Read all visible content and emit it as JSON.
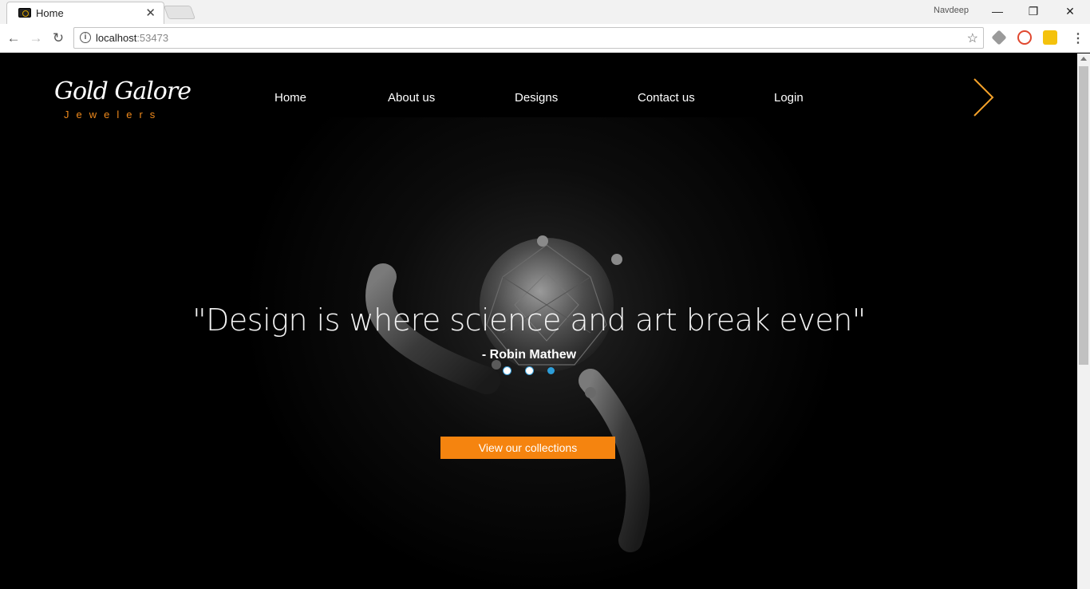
{
  "browser": {
    "tab_title": "Home",
    "tab_close": "✕",
    "profile_name": "Navdeep",
    "window_controls": {
      "minimize": "—",
      "restore": "❐",
      "close": "✕"
    },
    "nav": {
      "back": "←",
      "forward": "→",
      "reload": "↻"
    },
    "url_host": "localhost",
    "url_port": ":53473",
    "info_icon": "i",
    "bookmark_star": "☆",
    "menu": "⋮",
    "extensions": [
      "cube-extension-icon",
      "red-block-extension-icon",
      "yellow-extension-icon"
    ]
  },
  "site": {
    "logo_main": "Gold Galore",
    "logo_sub": "Jewelers",
    "nav_items": [
      "Home",
      "About us",
      "Designs",
      "Contact us",
      "Login"
    ],
    "hero": {
      "quote": "\"Design is where science and art break even\"",
      "author": "- Robin Mathew",
      "slides_total": 3,
      "active_slide": 3,
      "cta_label": "View our collections"
    },
    "colors": {
      "accent": "#f5840f",
      "dot_active": "#2d9ed9",
      "background": "#000000"
    }
  }
}
